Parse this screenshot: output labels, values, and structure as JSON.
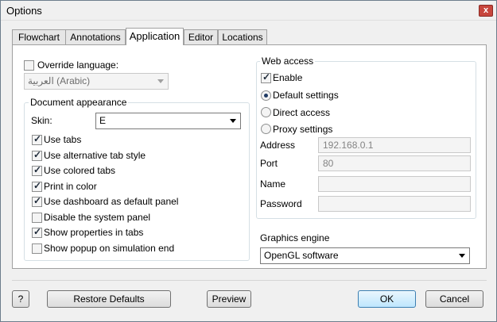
{
  "window": {
    "title": "Options",
    "close_label": "x"
  },
  "tabs": [
    "Flowchart",
    "Annotations",
    "Application",
    "Editor",
    "Locations"
  ],
  "active_tab": "Application",
  "language": {
    "label": "Override language:",
    "checked": false,
    "value": "العربية (Arabic)"
  },
  "appearance": {
    "group_label": "Document appearance",
    "skin_label": "Skin:",
    "skin_value": "E",
    "options": [
      {
        "label": "Use tabs",
        "checked": true
      },
      {
        "label": "Use alternative tab style",
        "checked": true
      },
      {
        "label": "Use colored tabs",
        "checked": true
      },
      {
        "label": "Print in color",
        "checked": true
      },
      {
        "label": "Use dashboard as default panel",
        "checked": true
      },
      {
        "label": "Disable the system panel",
        "checked": false
      },
      {
        "label": "Show properties in tabs",
        "checked": true
      },
      {
        "label": "Show popup on simulation end",
        "checked": false
      }
    ]
  },
  "web": {
    "group_label": "Web access",
    "enable_label": "Enable",
    "enable_checked": true,
    "modes": [
      {
        "label": "Default settings",
        "selected": true
      },
      {
        "label": "Direct access",
        "selected": false
      },
      {
        "label": "Proxy settings",
        "selected": false
      }
    ],
    "fields": {
      "address_label": "Address",
      "address_value": "192.168.0.1",
      "port_label": "Port",
      "port_value": "80",
      "name_label": "Name",
      "name_value": "",
      "password_label": "Password",
      "password_value": ""
    }
  },
  "graphics": {
    "label": "Graphics engine",
    "value": "OpenGL software"
  },
  "buttons": {
    "help": "?",
    "restore": "Restore Defaults",
    "preview": "Preview",
    "ok": "OK",
    "cancel": "Cancel"
  }
}
